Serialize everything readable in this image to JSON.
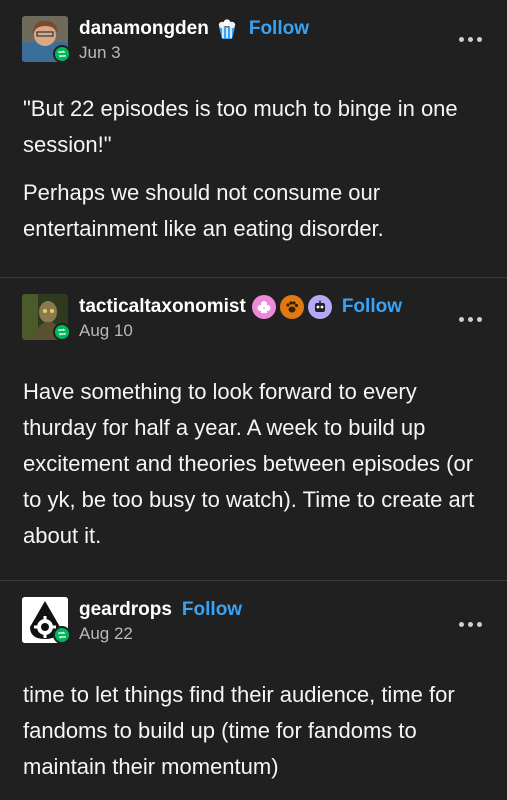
{
  "posts": [
    {
      "username": "danamongden",
      "follow_label": "Follow",
      "date": "Jun 3",
      "badges": [
        "popcorn-icon"
      ],
      "paragraphs": [
        "\"But 22 episodes is too much to binge in one session!\"",
        "Perhaps we should not consume our entertainment like an eating disorder."
      ]
    },
    {
      "username": "tacticaltaxonomist",
      "follow_label": "Follow",
      "date": "Aug 10",
      "badges": [
        "pink-flower-badge-icon",
        "paw-badge-icon",
        "robot-badge-icon"
      ],
      "paragraphs": [
        "Have something to look forward to every thurday for half a year. A week to build up excitement and theories between episodes (or to yk, be too busy to watch). Time to create art about it."
      ]
    },
    {
      "username": "geardrops",
      "follow_label": "Follow",
      "date": "Aug 22",
      "badges": [],
      "paragraphs": [
        "time to let things find their audience, time for fandoms to build up (time for fandoms to maintain their momentum)"
      ]
    }
  ],
  "colors": {
    "background": "#202020",
    "follow": "#38a3f5",
    "reblog_badge": "#00b85c",
    "date": "#b9b9b9"
  }
}
